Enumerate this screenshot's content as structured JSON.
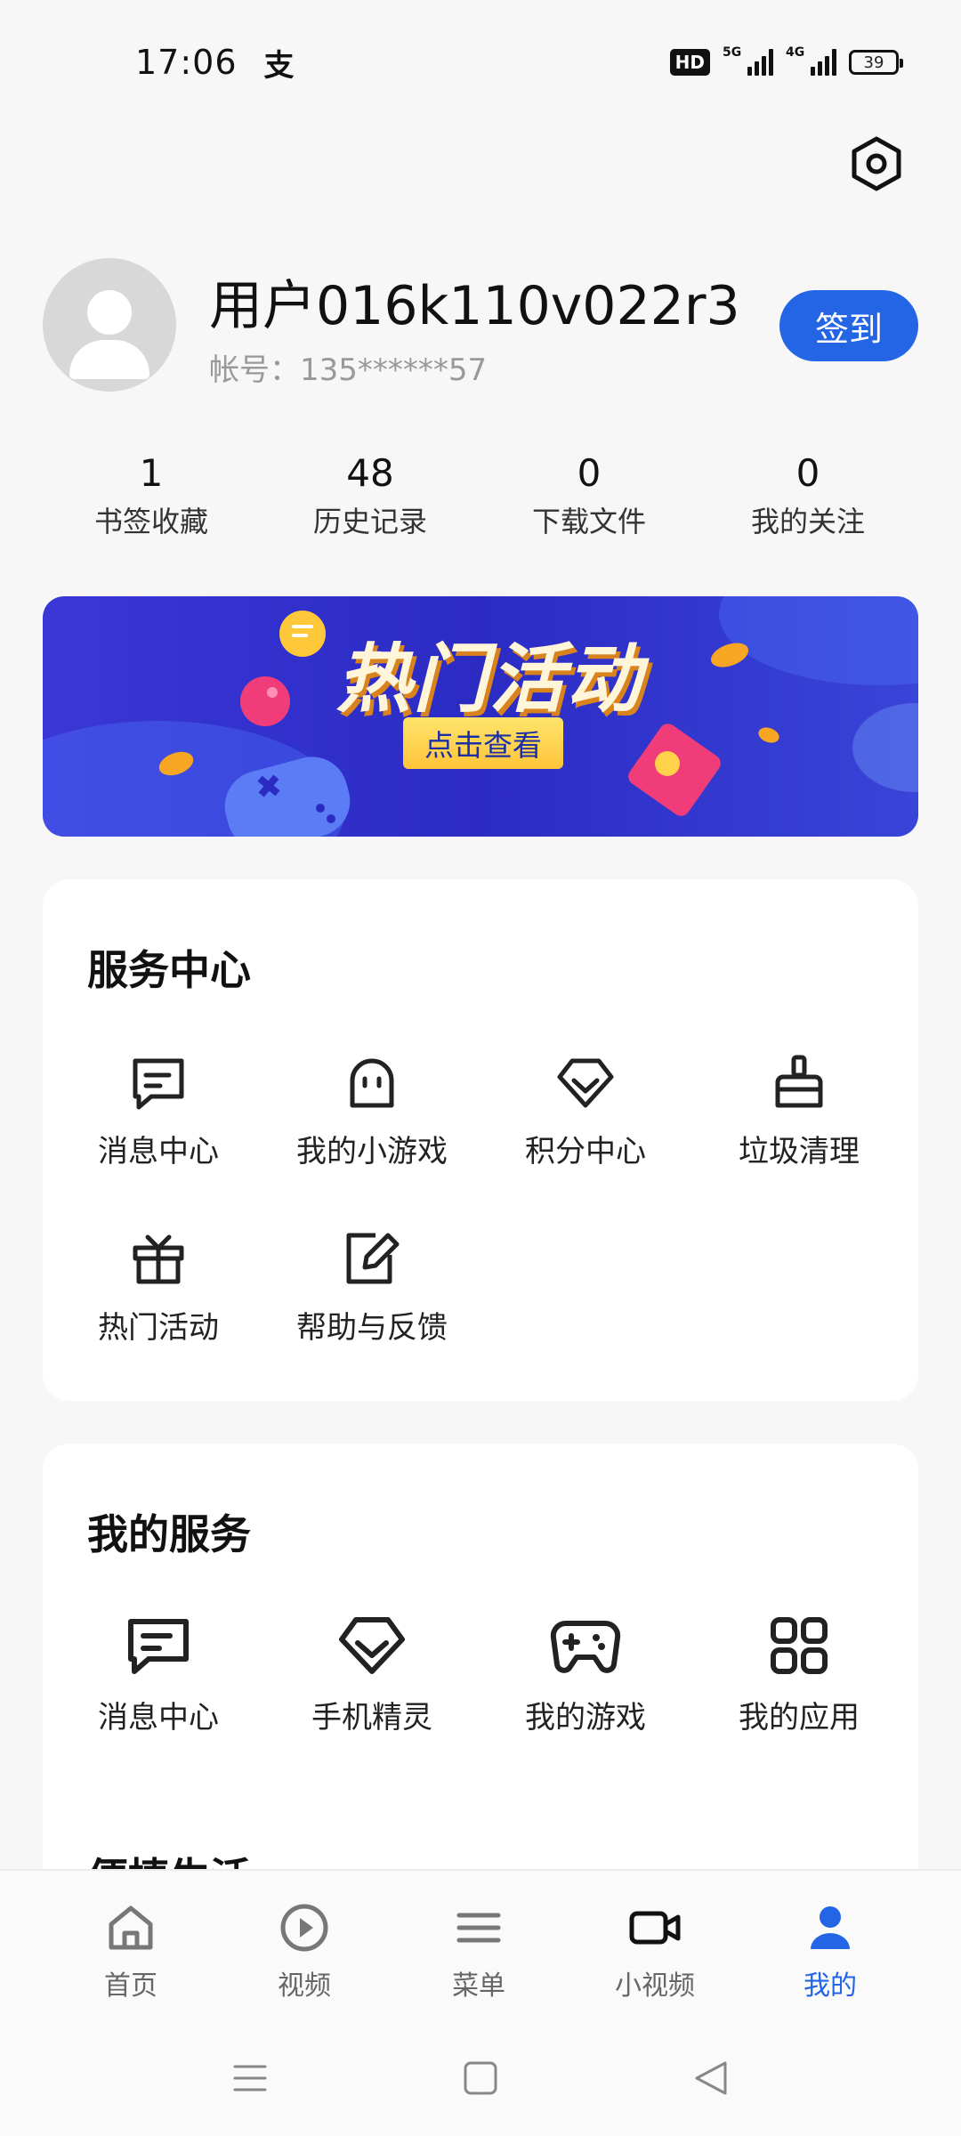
{
  "status_bar": {
    "time": "17:06",
    "alipay_glyph": "支",
    "hd_label": "HD",
    "network_1": "5G",
    "network_2": "4G",
    "battery": "39"
  },
  "profile": {
    "username": "用户016k110v022r3",
    "account": "帐号：135******57",
    "checkin_label": "签到"
  },
  "stats": [
    {
      "value": "1",
      "label": "书签收藏"
    },
    {
      "value": "48",
      "label": "历史记录"
    },
    {
      "value": "0",
      "label": "下载文件"
    },
    {
      "value": "0",
      "label": "我的关注"
    }
  ],
  "banner": {
    "title": "热门活动",
    "cta": "点击查看"
  },
  "service_center": {
    "title": "服务中心",
    "items": [
      {
        "label": "消息中心",
        "icon": "message-icon"
      },
      {
        "label": "我的小游戏",
        "icon": "ghost-icon"
      },
      {
        "label": "积分中心",
        "icon": "diamond-icon"
      },
      {
        "label": "垃圾清理",
        "icon": "broom-icon"
      },
      {
        "label": "热门活动",
        "icon": "gift-icon"
      },
      {
        "label": "帮助与反馈",
        "icon": "edit-icon"
      }
    ]
  },
  "my_services": {
    "title": "我的服务",
    "items": [
      {
        "label": "消息中心",
        "icon": "message-icon"
      },
      {
        "label": "手机精灵",
        "icon": "diamond-icon"
      },
      {
        "label": "我的游戏",
        "icon": "gamepad-icon"
      },
      {
        "label": "我的应用",
        "icon": "apps-grid-icon"
      }
    ],
    "next_section_title": "便捷生活"
  },
  "bottom_nav": [
    {
      "label": "首页",
      "icon": "home-icon",
      "active": false
    },
    {
      "label": "视频",
      "icon": "play-icon",
      "active": false
    },
    {
      "label": "菜单",
      "icon": "menu-icon",
      "active": false
    },
    {
      "label": "小视频",
      "icon": "video-camera-icon",
      "active": false
    },
    {
      "label": "我的",
      "icon": "person-icon",
      "active": true
    }
  ],
  "colors": {
    "accent": "#2465e6",
    "background": "#f7f7f8",
    "banner": "#2b2bc4"
  }
}
